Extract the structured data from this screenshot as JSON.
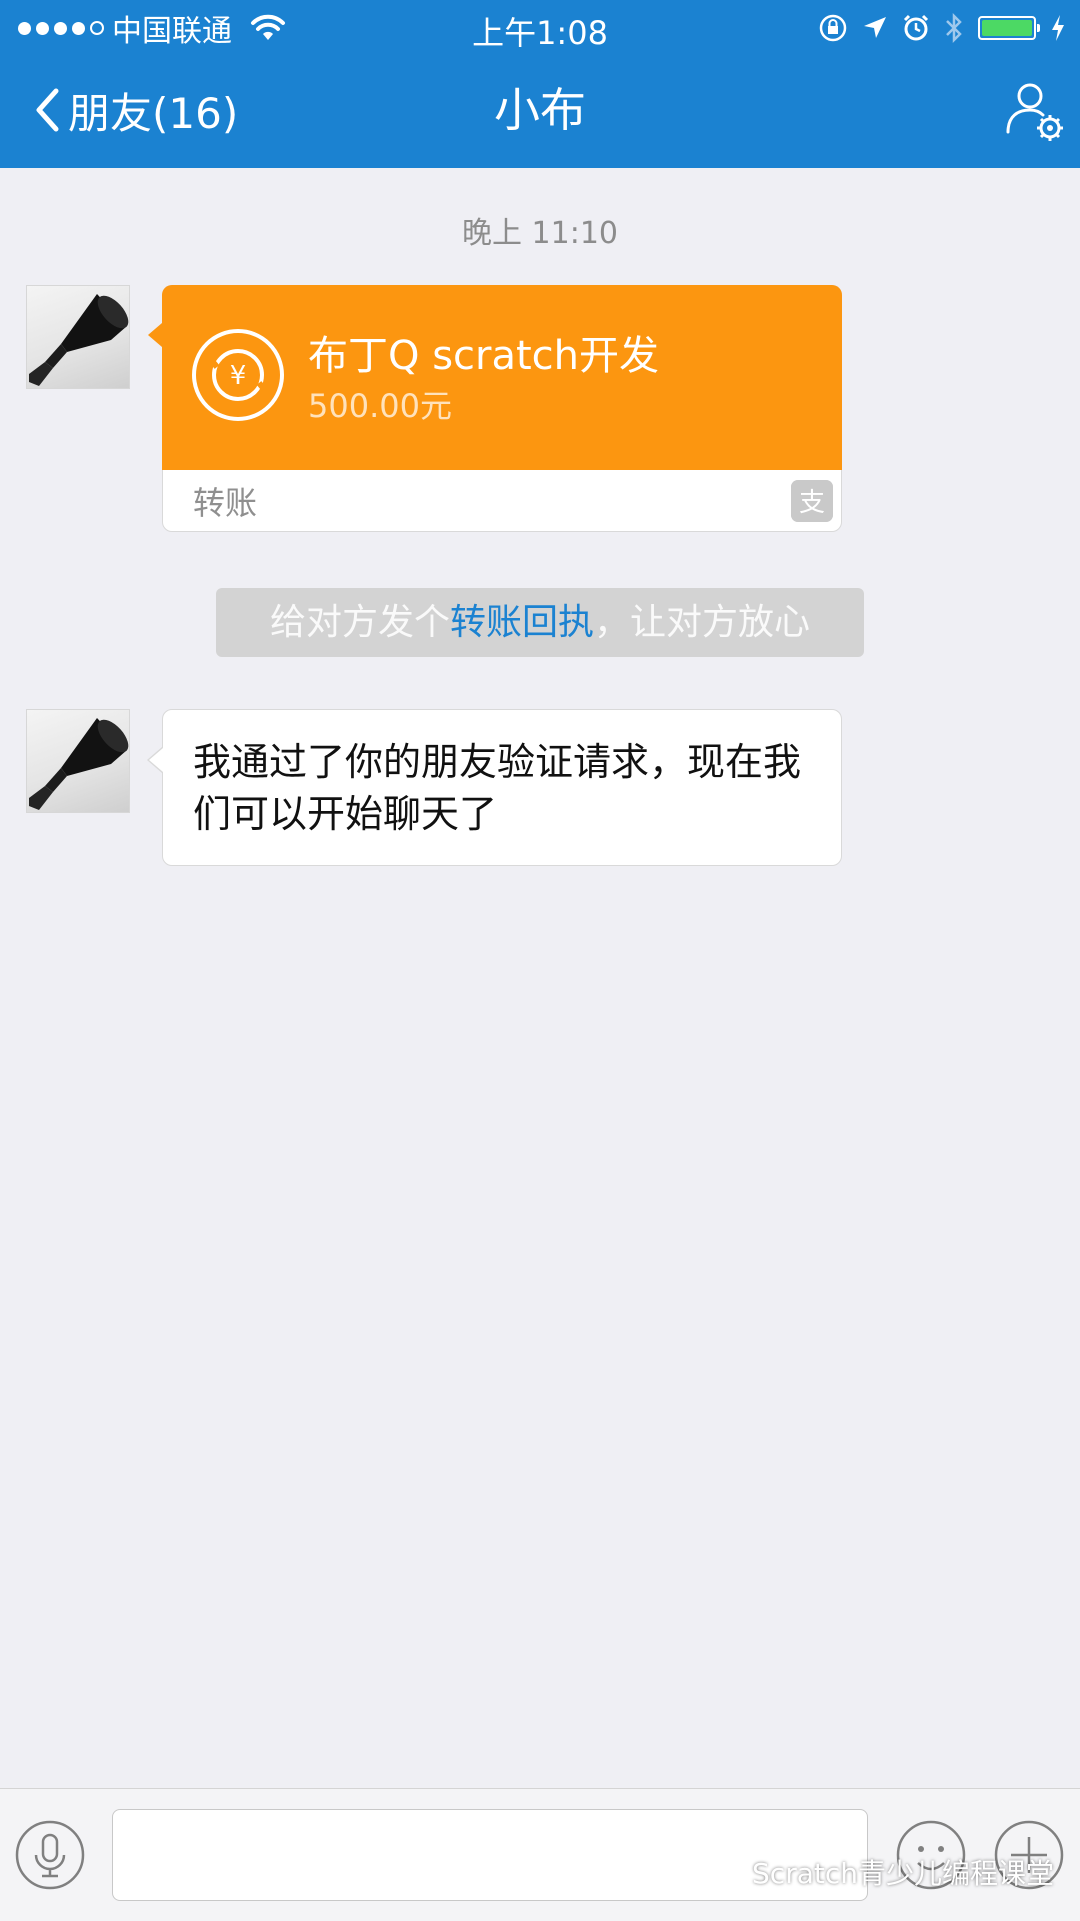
{
  "status_bar": {
    "carrier": "中国联通",
    "time": "上午1:08",
    "signal_filled": 4,
    "signal_total": 5,
    "battery_level": 1.0
  },
  "nav": {
    "back_label": "朋友(16)",
    "title": "小布",
    "back_icon": "chevron-left-icon",
    "profile_icon": "user-settings-icon"
  },
  "chat": {
    "timestamp": "晚上 11:10",
    "transfer": {
      "title": "布丁Q scratch开发",
      "amount": "500.00元",
      "type_label": "转账",
      "coin_symbol": "¥",
      "alipay_glyph": "支",
      "color": "#fc9610"
    },
    "hint": {
      "prefix": "给对方发个",
      "link": "转账回执",
      "suffix": "，让对方放心"
    },
    "message": "我通过了你的朋友验证请求，现在我们可以开始聊天了"
  },
  "input_bar": {
    "placeholder": "",
    "mic_icon": "microphone-icon",
    "emoji_icon": "emoji-icon",
    "plus_icon": "plus-icon"
  },
  "watermark": "Scratch青少儿编程课堂",
  "colors": {
    "accent": "#1b82d1",
    "transfer": "#fc9610",
    "background": "#efeff4"
  }
}
